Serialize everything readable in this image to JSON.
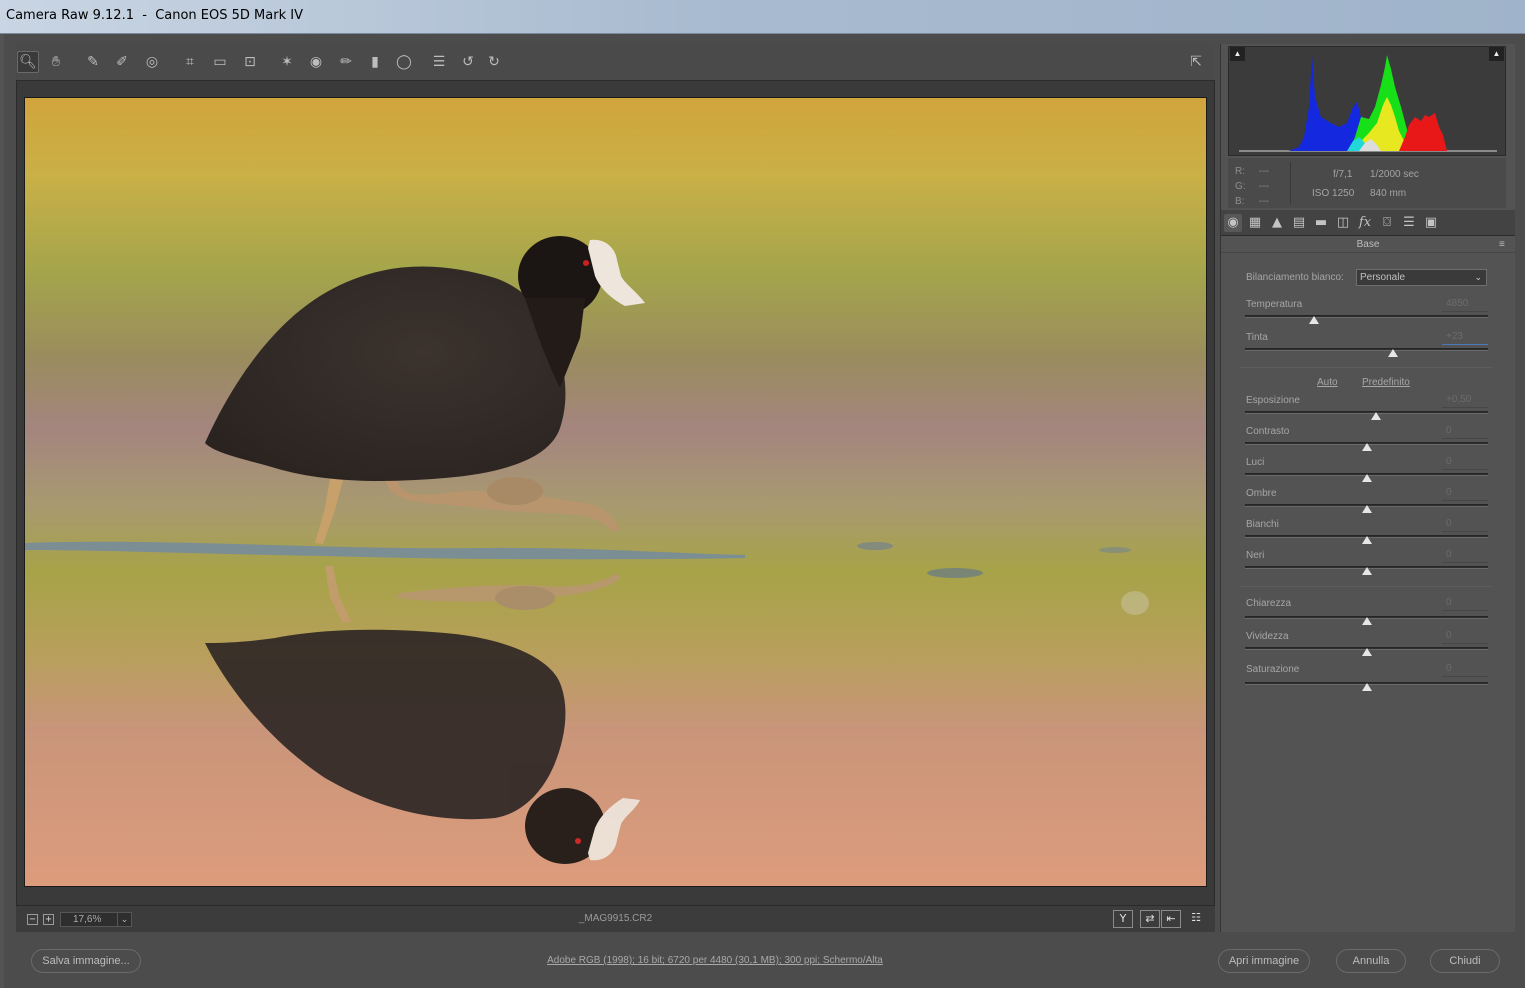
{
  "window": {
    "title": "Camera Raw 9.12.1  -  Canon EOS 5D Mark IV"
  },
  "toolbar": {
    "tools": [
      {
        "name": "zoom-tool-icon",
        "glyph": "🔍︎"
      },
      {
        "name": "hand-tool-icon",
        "glyph": "✋︎"
      },
      {
        "name": "white-balance-tool-icon",
        "glyph": "✎"
      },
      {
        "name": "color-sampler-tool-icon",
        "glyph": "✐"
      },
      {
        "name": "targeted-adjustment-tool-icon",
        "glyph": "◎"
      },
      {
        "name": "crop-tool-icon",
        "glyph": "⌗"
      },
      {
        "name": "straighten-tool-icon",
        "glyph": "▭"
      },
      {
        "name": "transform-tool-icon",
        "glyph": "⊡"
      },
      {
        "name": "spot-removal-tool-icon",
        "glyph": "✶"
      },
      {
        "name": "red-eye-removal-icon",
        "glyph": "◉"
      },
      {
        "name": "adjustment-brush-icon",
        "glyph": "✏"
      },
      {
        "name": "graduated-filter-icon",
        "glyph": "▮"
      },
      {
        "name": "radial-filter-icon",
        "glyph": "◯"
      },
      {
        "name": "preferences-icon",
        "glyph": "☰"
      },
      {
        "name": "rotate-left-icon",
        "glyph": "↺"
      },
      {
        "name": "rotate-right-icon",
        "glyph": "↻"
      }
    ],
    "fullscreen_glyph": "⇱"
  },
  "statusbar": {
    "zoom_out": "−",
    "zoom_in": "+",
    "zoom_value": "17,6%",
    "zoom_dropdown": "⌄",
    "filename": "_MAG9915.CR2",
    "view_buttons": [
      "Y",
      "⇄",
      "⇤",
      "☷"
    ]
  },
  "histogram": {
    "clip_shadow": "▲",
    "clip_highlight": "▲"
  },
  "info": {
    "r_label": "R:",
    "r_value": "---",
    "g_label": "G:",
    "g_value": "---",
    "b_label": "B:",
    "b_value": "---",
    "aperture": "f/7,1",
    "shutter": "1/2000 sec",
    "iso": "ISO 1250",
    "focal": "840 mm"
  },
  "panel_tabs": [
    {
      "name": "tab-basic-icon",
      "glyph": "◉"
    },
    {
      "name": "tab-tone-curve-icon",
      "glyph": "▦"
    },
    {
      "name": "tab-detail-icon",
      "glyph": "▲"
    },
    {
      "name": "tab-hsl-icon",
      "glyph": "▤"
    },
    {
      "name": "tab-split-toning-icon",
      "glyph": "▬"
    },
    {
      "name": "tab-lens-corrections-icon",
      "glyph": "◫"
    },
    {
      "name": "tab-effects-icon",
      "glyph": "fx"
    },
    {
      "name": "tab-camera-calibration-icon",
      "glyph": "⌼"
    },
    {
      "name": "tab-presets-icon",
      "glyph": "☰"
    },
    {
      "name": "tab-snapshots-icon",
      "glyph": "▣"
    }
  ],
  "panel": {
    "title": "Base",
    "menu_glyph": "≡",
    "wb_label": "Bilanciamento bianco:",
    "wb_value": "Personale",
    "wb_arrow": "⌄",
    "auto": "Auto",
    "default": "Predefinito"
  },
  "sliders": [
    {
      "label": "Temperatura",
      "value": "4850",
      "pos": 0.285
    },
    {
      "label": "Tinta",
      "value": "+23",
      "pos": 0.61
    },
    {
      "label": "Esposizione",
      "value": "+0,50",
      "pos": 0.54
    },
    {
      "label": "Contrasto",
      "value": "0",
      "pos": 0.5
    },
    {
      "label": "Luci",
      "value": "0",
      "pos": 0.5
    },
    {
      "label": "Ombre",
      "value": "0",
      "pos": 0.5
    },
    {
      "label": "Bianchi",
      "value": "0",
      "pos": 0.5
    },
    {
      "label": "Neri",
      "value": "0",
      "pos": 0.5
    },
    {
      "label": "Chiarezza",
      "value": "0",
      "pos": 0.5
    },
    {
      "label": "Vividezza",
      "value": "0",
      "pos": 0.5
    },
    {
      "label": "Saturazione",
      "value": "0",
      "pos": 0.5
    }
  ],
  "bottom": {
    "save": "Salva immagine...",
    "workflow": "Adobe RGB (1998); 16 bit; 6720 per 4480 (30,1 MB); 300 ppi; Schermo/Alta",
    "open": "Apri immagine",
    "cancel": "Annulla",
    "close": "Chiudi"
  },
  "colors": {
    "accent": "#4a78b8",
    "panel_bg": "#535353",
    "image_bg": "#3a3a3a"
  }
}
